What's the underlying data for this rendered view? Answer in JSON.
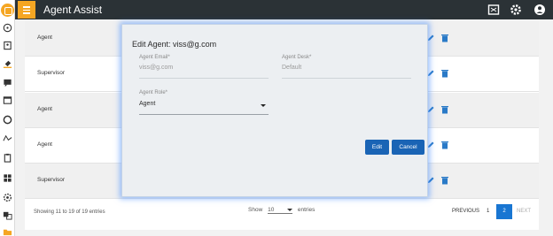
{
  "app": {
    "title": "Agent Assist"
  },
  "table": {
    "rows": [
      {
        "role": "Agent"
      },
      {
        "role": "Supervisor"
      },
      {
        "role": "Agent"
      },
      {
        "role": "Agent"
      },
      {
        "role": "Supervisor"
      }
    ],
    "entries_text": "Showing 11 to 19 of 19 entries",
    "show_label": "Show",
    "show_value": "10",
    "entries_label": "entries"
  },
  "pagination": {
    "previous": "PREVIOUS",
    "pages": [
      "1",
      "2"
    ],
    "current": "2",
    "next": "NEXT"
  },
  "modal": {
    "title": "Edit Agent: viss@g.com",
    "email_label": "Agent Email*",
    "email_value": "viss@g.com",
    "desk_label": "Agent Desk*",
    "desk_value": "Default",
    "role_label": "Agent Role*",
    "role_value": "Agent",
    "edit_button": "Edit",
    "cancel_button": "Cancel"
  },
  "colors": {
    "accent": "#f5a623",
    "primary": "#1976d2",
    "topbar": "#2b3236"
  },
  "icons": {
    "rail": [
      "app-logo-icon",
      "dashboard-icon",
      "contacts-icon",
      "paint-icon",
      "chat-icon",
      "window-icon",
      "circle-icon",
      "analytics-icon",
      "clipboard-icon",
      "grid-icon",
      "settings-icon",
      "translate-icon",
      "folder-icon"
    ],
    "topbar": [
      "fullscreen-icon",
      "gear-icon",
      "account-icon"
    ]
  }
}
